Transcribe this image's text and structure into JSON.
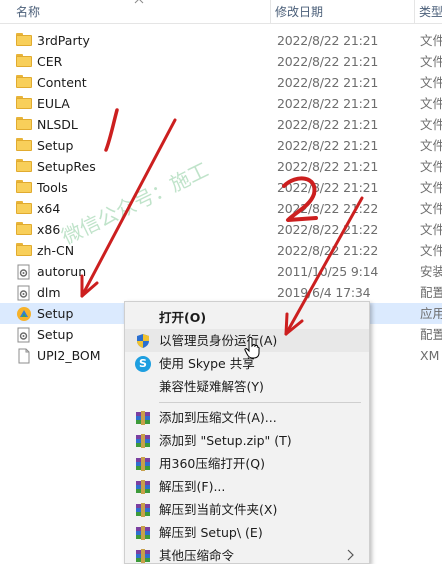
{
  "header": {
    "name_label": "名称",
    "date_label": "修改日期",
    "type_label": "类型"
  },
  "files": [
    {
      "name": "3rdParty",
      "date": "2022/8/22 21:21",
      "type": "文件",
      "icon": "folder-icon"
    },
    {
      "name": "CER",
      "date": "2022/8/22 21:21",
      "type": "文件",
      "icon": "folder-icon"
    },
    {
      "name": "Content",
      "date": "2022/8/22 21:21",
      "type": "文件",
      "icon": "folder-icon"
    },
    {
      "name": "EULA",
      "date": "2022/8/22 21:21",
      "type": "文件",
      "icon": "folder-icon"
    },
    {
      "name": "NLSDL",
      "date": "2022/8/22 21:21",
      "type": "文件",
      "icon": "folder-icon"
    },
    {
      "name": "Setup",
      "date": "2022/8/22 21:21",
      "type": "文件",
      "icon": "folder-icon"
    },
    {
      "name": "SetupRes",
      "date": "2022/8/22 21:21",
      "type": "文件",
      "icon": "folder-icon"
    },
    {
      "name": "Tools",
      "date": "2022/8/22 21:21",
      "type": "文件",
      "icon": "folder-icon"
    },
    {
      "name": "x64",
      "date": "2022/8/22 21:22",
      "type": "文件",
      "icon": "folder-icon"
    },
    {
      "name": "x86",
      "date": "2022/8/22 21:22",
      "type": "文件",
      "icon": "folder-icon"
    },
    {
      "name": "zh-CN",
      "date": "2022/8/22 21:22",
      "type": "文件",
      "icon": "folder-icon"
    },
    {
      "name": "autorun",
      "date": "2011/10/25 9:14",
      "type": "安装",
      "icon": "settings-file-icon"
    },
    {
      "name": "dlm",
      "date": "2019/6/4 17:34",
      "type": "配置",
      "icon": "settings-file-icon"
    },
    {
      "name": "Setup",
      "date": "",
      "type": "应用",
      "icon": "setup-app-icon"
    },
    {
      "name": "Setup",
      "date": "",
      "type": "配置",
      "icon": "settings-file-icon"
    },
    {
      "name": "UPI2_BOM",
      "date": "",
      "type": "XM",
      "icon": "document-icon"
    }
  ],
  "context_menu": {
    "items": [
      {
        "label": "打开(O)",
        "icon": "",
        "bold": true
      },
      {
        "label": "以管理员身份运行(A)",
        "icon": "uac-shield-icon"
      },
      {
        "label": "使用 Skype 共享",
        "icon": "skype-icon"
      },
      {
        "label": "兼容性疑难解答(Y)",
        "icon": ""
      },
      {
        "label": "添加到压缩文件(A)...",
        "icon": "winrar-archive-icon"
      },
      {
        "label": "添加到 \"Setup.zip\" (T)",
        "icon": "winrar-archive-icon"
      },
      {
        "label": "用360压缩打开(Q)",
        "icon": "winrar-archive-icon"
      },
      {
        "label": "解压到(F)...",
        "icon": "winrar-archive-icon"
      },
      {
        "label": "解压到当前文件夹(X)",
        "icon": "winrar-archive-icon"
      },
      {
        "label": "解压到 Setup\\ (E)",
        "icon": "winrar-archive-icon"
      },
      {
        "label": "其他压缩命令",
        "icon": "winrar-archive-icon"
      }
    ]
  },
  "watermark": "微信公众号：施工",
  "annotations": {
    "number_2_label": "2",
    "color": "#cc1f1f"
  },
  "colors": {
    "selection": "#dbeafe",
    "menu_bg": "#f2f2f2",
    "folder": "#f8cf5a"
  }
}
